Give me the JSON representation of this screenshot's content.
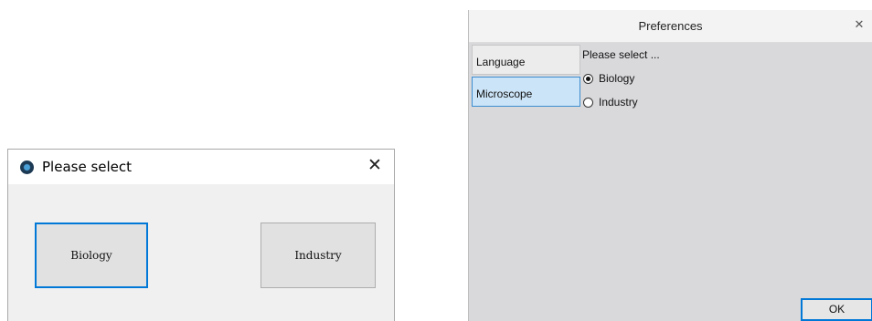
{
  "left_dialog": {
    "title": "Please select",
    "close_glyph": "✕",
    "buttons": {
      "biology": "Biology",
      "industry": "Industry"
    }
  },
  "right_dialog": {
    "title": "Preferences",
    "close_glyph": "✕",
    "tabs": [
      {
        "label": "Language",
        "active": false
      },
      {
        "label": "Microscope",
        "active": true
      }
    ],
    "prompt": "Please select ...",
    "options": [
      {
        "label": "Biology",
        "checked": true
      },
      {
        "label": "Industry",
        "checked": false
      }
    ],
    "ok_label": "OK"
  },
  "colors": {
    "accent": "#0078d7",
    "active_tab_bg": "#cce4f7",
    "panel_bg": "#d9d9dc"
  }
}
